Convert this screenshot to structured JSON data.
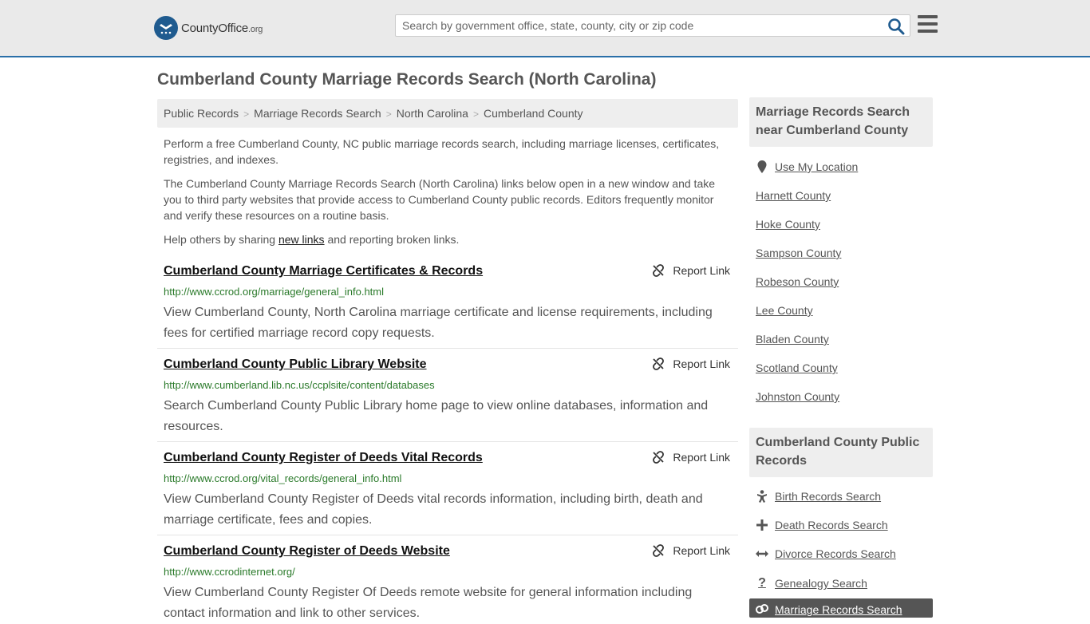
{
  "header": {
    "logo_name": "County",
    "logo_name_bold": "Office",
    "logo_tld": ".org",
    "search_placeholder": "Search by government office, state, county, city or zip code"
  },
  "page_title": "Cumberland County Marriage Records Search (North Carolina)",
  "breadcrumb": [
    "Public Records",
    "Marriage Records Search",
    "North Carolina",
    "Cumberland County"
  ],
  "intro": {
    "p1": "Perform a free Cumberland County, NC public marriage records search, including marriage licenses, certificates, registries, and indexes.",
    "p2": "The Cumberland County Marriage Records Search (North Carolina) links below open in a new window and take you to third party websites that provide access to Cumberland County public records. Editors frequently monitor and verify these resources on a routine basis.",
    "p3_before": "Help others by sharing ",
    "p3_link": "new links",
    "p3_after": " and reporting broken links."
  },
  "report_label": "Report Link",
  "results": [
    {
      "title": "Cumberland County Marriage Certificates & Records",
      "url": "http://www.ccrod.org/marriage/general_info.html",
      "desc": "View Cumberland County, North Carolina marriage certificate and license requirements, including fees for certified marriage record copy requests."
    },
    {
      "title": "Cumberland County Public Library Website",
      "url": "http://www.cumberland.lib.nc.us/ccplsite/content/databases",
      "desc": "Search Cumberland County Public Library home page to view online databases, information and resources."
    },
    {
      "title": "Cumberland County Register of Deeds Vital Records",
      "url": "http://www.ccrod.org/vital_records/general_info.html",
      "desc": "View Cumberland County Register of Deeds vital records information, including birth, death and marriage certificate, fees and copies."
    },
    {
      "title": "Cumberland County Register of Deeds Website",
      "url": "http://www.ccrodinternet.org/",
      "desc": "View Cumberland County Register Of Deeds remote website for general information including contact information and link to other services."
    }
  ],
  "sidebar": {
    "nearby_heading": "Marriage Records Search near Cumberland County",
    "use_location": "Use My Location",
    "nearby": [
      "Harnett County",
      "Hoke County",
      "Sampson County",
      "Robeson County",
      "Lee County",
      "Bladen County",
      "Scotland County",
      "Johnston County"
    ],
    "public_heading": "Cumberland County Public Records",
    "public_links": [
      {
        "label": "Birth Records Search",
        "icon": "baby-icon"
      },
      {
        "label": "Death Records Search",
        "icon": "cross-icon"
      },
      {
        "label": "Divorce Records Search",
        "icon": "split-arrows-icon"
      },
      {
        "label": "Genealogy Search",
        "icon": "question-icon"
      }
    ],
    "active_link": {
      "label": "Marriage Records Search",
      "icon": "rings-icon"
    }
  }
}
